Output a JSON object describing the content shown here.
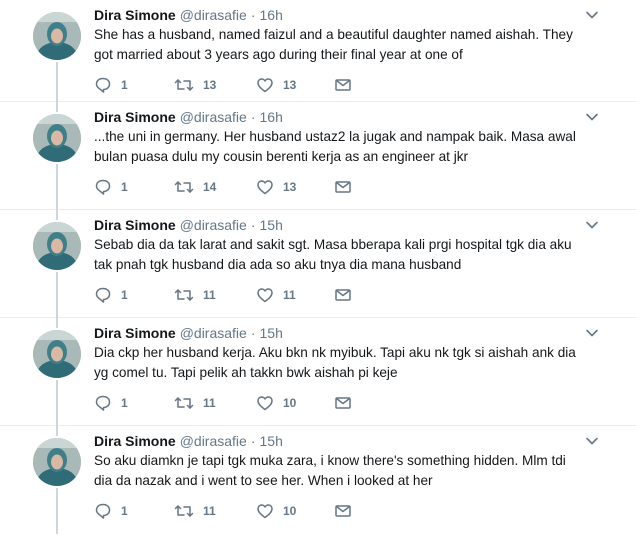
{
  "tweets": [
    {
      "author_name": "Dira Simone",
      "handle": "@dirasafie",
      "separator": "·",
      "time": "16h",
      "text": "She has a husband, named faizul and a beautiful daughter named aishah. They\ngot married about 3 years ago during their final year at one of",
      "replies": "1",
      "retweets": "13",
      "likes": "13"
    },
    {
      "author_name": "Dira Simone",
      "handle": "@dirasafie",
      "separator": "·",
      "time": "16h",
      "text": "...the uni in germany. Her husband ustaz2 la jugak and nampak baik. Masa awal\nbulan puasa dulu my cousin berenti kerja as an engineer at jkr",
      "replies": "1",
      "retweets": "14",
      "likes": "13"
    },
    {
      "author_name": "Dira Simone",
      "handle": "@dirasafie",
      "separator": "·",
      "time": "15h",
      "text": "Sebab dia da tak larat and sakit sgt. Masa bberapa kali prgi hospital tgk dia aku\ntak pnah tgk husband dia ada so aku tnya dia mana husband",
      "replies": "1",
      "retweets": "11",
      "likes": "11"
    },
    {
      "author_name": "Dira Simone",
      "handle": "@dirasafie",
      "separator": "·",
      "time": "15h",
      "text": "Dia ckp her husband kerja. Aku bkn nk myibuk. Tapi aku nk tgk si aishah ank dia\nyg comel tu. Tapi pelik ah takkn bwk aishah pi keje",
      "replies": "1",
      "retweets": "11",
      "likes": "10"
    },
    {
      "author_name": "Dira Simone",
      "handle": "@dirasafie",
      "separator": "·",
      "time": "15h",
      "text": "So aku diamkn je tapi tgk muka zara, i know there's something hidden. Mlm tdi\ndia da nazak and i went to see her. When i looked at her",
      "replies": "1",
      "retweets": "11",
      "likes": "10"
    }
  ],
  "icons": {
    "reply": "reply-icon",
    "retweet": "retweet-icon",
    "like": "heart-icon",
    "message": "envelope-icon",
    "caret": "chevron-down-icon"
  },
  "colors": {
    "name": "#14171a",
    "meta": "#657786",
    "thread_line": "#ccd6dd",
    "divider": "#e6ecf0"
  }
}
